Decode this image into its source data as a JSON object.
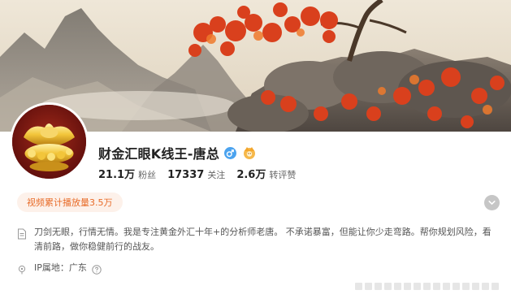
{
  "profile": {
    "name": "财金汇眼K线王-唐总",
    "gender_icon": "male-icon",
    "badge_icon": "gold-crown-badge-icon"
  },
  "stats": [
    {
      "value": "21.1万",
      "label": "粉丝"
    },
    {
      "value": "17337",
      "label": "关注"
    },
    {
      "value": "2.6万",
      "label": "转评赞"
    }
  ],
  "views_pill": "视频累计播放量3.5万",
  "bio": "刀剑无眼，行情无情。我是专注黄金外汇十年+的分析师老唐。 不承诺暴富，但能让你少走弯路。帮你规划风险，看清前路，做你稳健前行的战友。",
  "location": "IP属地：广东",
  "colors": {
    "accent_orange": "#e86b28",
    "pill_bg": "#fdf1ea",
    "gender_blue": "#4ba3ef",
    "text_dark": "#222222",
    "text_muted": "#555555"
  }
}
